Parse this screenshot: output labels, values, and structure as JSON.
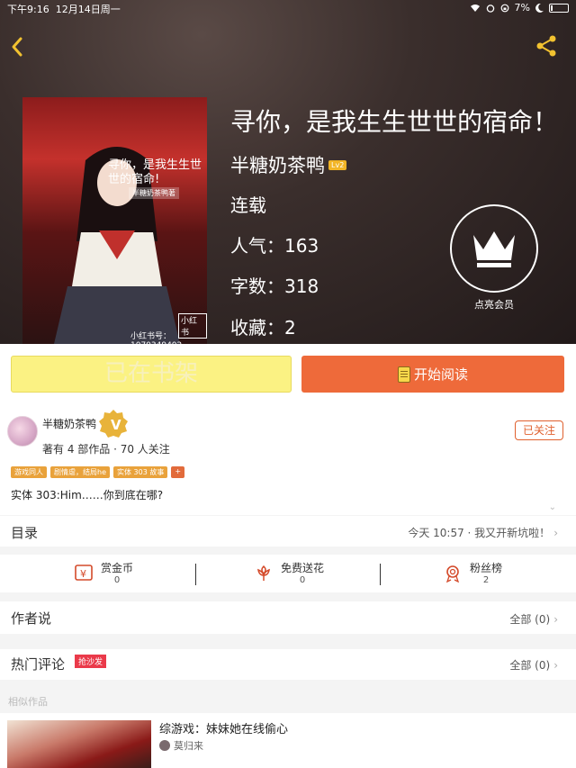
{
  "statusbar": {
    "time": "下午9:16",
    "date": "12月14日周一",
    "battery": "7%"
  },
  "book": {
    "title": "寻你，是我生生世世的宿命！",
    "author": "半糖奶茶鸭",
    "author_level": "Lv2",
    "status": "连载",
    "popularity": "人气：163",
    "word_count": "字数：318",
    "favorites": "收藏：2"
  },
  "cover": {
    "title": "寻你，是我生生世世的宿命!",
    "author_tag": "半糖奶茶鸭著",
    "badge": "小红书",
    "book_no": "小红书号：1070349402"
  },
  "vip": {
    "label": "点亮会员"
  },
  "actions": {
    "on_shelf": "已在书架",
    "start_reading": "开始阅读"
  },
  "author_card": {
    "name": "半糖奶茶鸭",
    "summary": "著有 4 部作品 · 70 人关注",
    "follow_state": "已关注",
    "tags": [
      "游戏同人",
      "剧情虐，结局he",
      "实体 303 故事",
      "+"
    ],
    "intro": "实体 303:Him……你到底在哪?"
  },
  "toc": {
    "title": "目录",
    "latest": "今天 10:57 · 我又开新坑啦！"
  },
  "stats": [
    {
      "label": "赏金币",
      "value": "0",
      "icon": "coin-icon"
    },
    {
      "label": "免费送花",
      "value": "0",
      "icon": "flower-icon"
    },
    {
      "label": "粉丝榜",
      "value": "2",
      "icon": "medal-icon"
    }
  ],
  "author_says": {
    "title": "作者说",
    "count": "全部 (0)"
  },
  "hot_comments": {
    "title": "热门评论",
    "badge": "抢沙发",
    "count": "全部 (0)"
  },
  "similar": {
    "label": "相似作品",
    "items": [
      {
        "title": "综游戏：妹妹她在线偷心",
        "author": "莫归来"
      }
    ]
  },
  "colors": {
    "accent": "#ee6a3a",
    "shelf": "#fbf283",
    "gold": "#f2b526"
  }
}
